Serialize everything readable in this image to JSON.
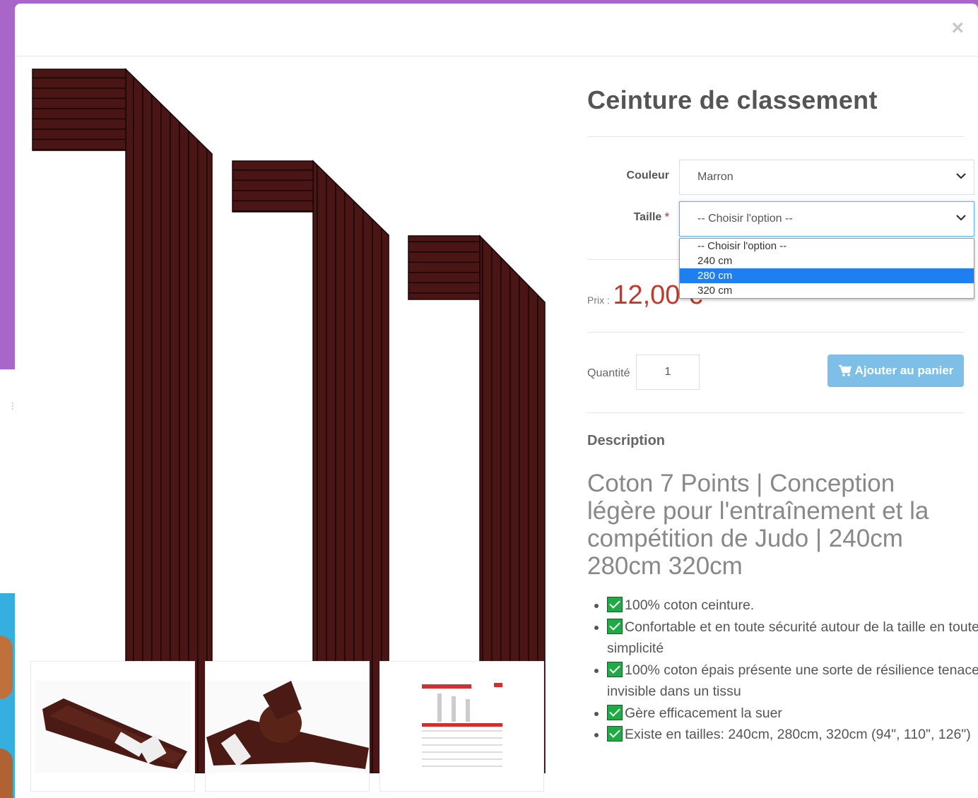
{
  "modal": {
    "close_label": "×"
  },
  "product": {
    "title": "Ceinture de classement",
    "options": [
      {
        "label": "Couleur",
        "required": false,
        "value": "Marron"
      },
      {
        "label": "Taille",
        "required": true,
        "required_mark": "*",
        "value": "-- Choisir l'option --"
      }
    ],
    "size_dropdown": {
      "items": [
        "-- Choisir l'option --",
        "240 cm",
        "280 cm",
        "320 cm"
      ],
      "highlighted": "280 cm"
    },
    "price_label": "Prix :",
    "price": "12,00 €",
    "quantity_label": "Quantité",
    "quantity": "1",
    "add_to_cart_label": "Ajouter au panier",
    "description_heading": "Description",
    "description_text": "Coton 7 Points | Conception légère pour l'entraînement et la compétition de Judo | 240cm 280cm 320cm",
    "bullets": [
      "100% coton ceinture.",
      "Confortable et en toute sécurité autour de la taille en toute simplicité",
      "100% coton épais présente une sorte de résilience tenace invisible dans un tissu",
      "Gère efficacement la suer",
      "Existe en tailles: 240cm, 280cm, 320cm (94\", 110\", 126\")"
    ]
  },
  "colors": {
    "belt": "#4a1515",
    "price": "#c0392b",
    "cart_button": "#7ebfe8",
    "dropdown_highlight": "#1e7ff0",
    "check": "#1faa44"
  }
}
